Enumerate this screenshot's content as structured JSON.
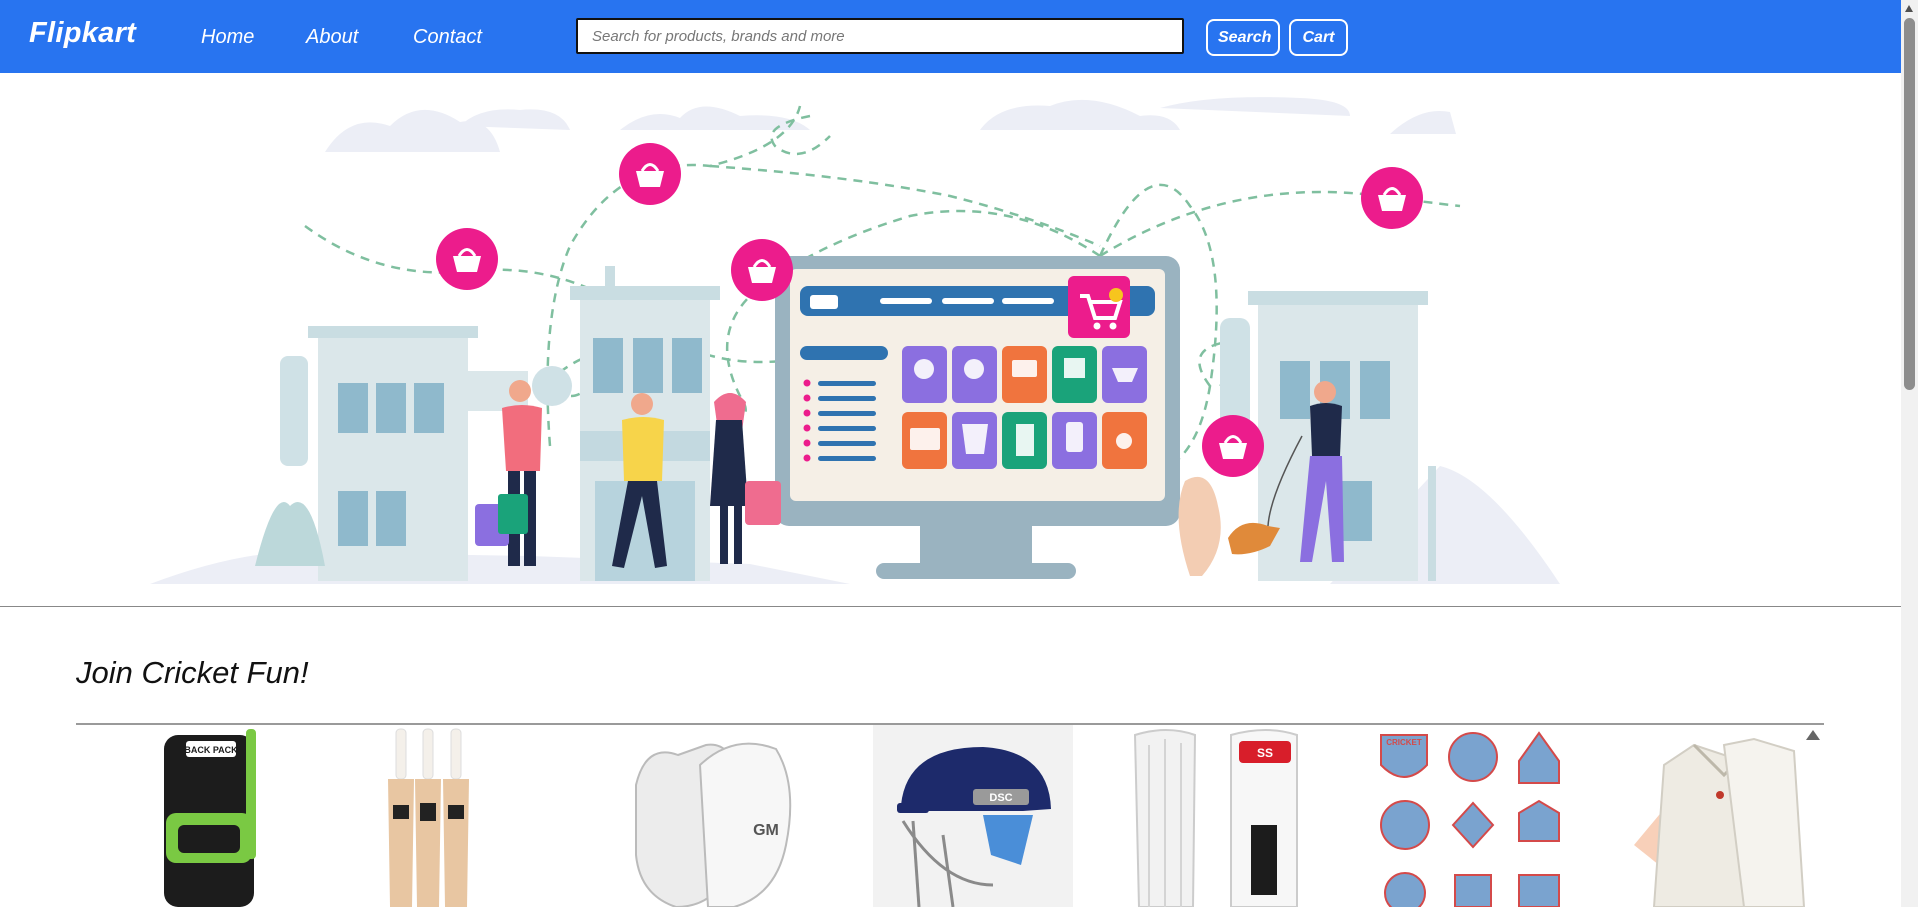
{
  "navbar": {
    "brand": "Flipkart",
    "links": [
      "Home",
      "About",
      "Contact"
    ],
    "search_placeholder": "Search for products, brands and more",
    "search_button": "Search",
    "cart_button": "Cart",
    "color": "#2874f0"
  },
  "hero": {
    "accent_pink": "#ec1c8c",
    "screen_blue": "#2f73b0"
  },
  "section": {
    "title": "Join Cricket Fun!",
    "products": [
      {
        "icon": "cricket-kit-bag-icon",
        "text": "BACK PACK"
      },
      {
        "icon": "cricket-bats-icon"
      },
      {
        "icon": "batting-gloves-icon",
        "text": "GM"
      },
      {
        "icon": "cricket-helmet-icon",
        "text": "DSC"
      },
      {
        "icon": "batting-pads-icon",
        "text": "SS"
      },
      {
        "icon": "cricket-badges-icon",
        "text": "CRICKET"
      },
      {
        "icon": "cricket-shirts-icon"
      }
    ]
  }
}
